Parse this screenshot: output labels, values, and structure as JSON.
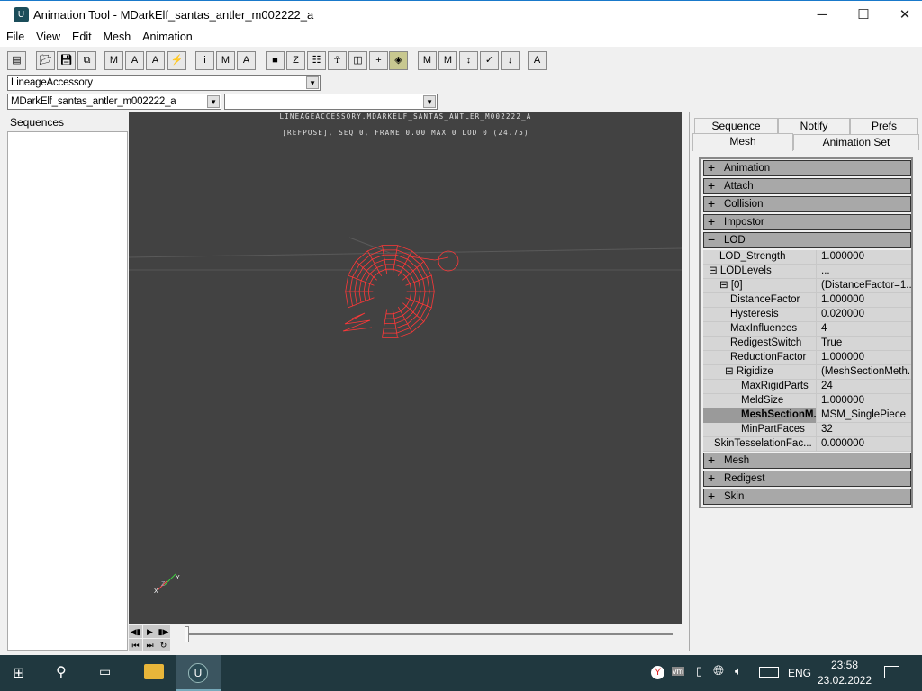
{
  "window": {
    "title": "Animation Tool - MDarkElf_santas_antler_m002222_a",
    "minimize": "─",
    "maximize": "☐",
    "close": "✕"
  },
  "menu": [
    "File",
    "View",
    "Edit",
    "Mesh",
    "Animation"
  ],
  "toolbar": [
    "browser",
    "open",
    "save",
    "copy",
    "mesh-props",
    "anim-props",
    "add-anim",
    "link",
    "info",
    "mesh-import",
    "anim-import",
    "box",
    "bones",
    "skeleton",
    "figure",
    "wireframe",
    "pivot",
    "lod",
    "mesh-export",
    "mesh-save",
    "redigest",
    "check",
    "import-down",
    "actor"
  ],
  "combos": {
    "package": "LineageAccessory",
    "mesh": "MDarkElf_santas_antler_m002222_a",
    "animset": ""
  },
  "left": {
    "sequences_label": "Sequences"
  },
  "viewport": {
    "line1": "LINEAGEACCESSORY.MDARKELF_SANTAS_ANTLER_M002222_A",
    "line2": "[REFPOSE], SEQ 0,  FRAME  0.00 MAX 0  LOD 0 (24.75)",
    "axis": {
      "x": "X",
      "y": "Y",
      "z": "Z"
    },
    "mesh_color": "#ff3838"
  },
  "timeline": {
    "position": 0
  },
  "tabs": {
    "row1": [
      "Sequence",
      "Notify",
      "Prefs"
    ],
    "row2": [
      "Mesh",
      "Animation Set"
    ],
    "active": "Mesh"
  },
  "properties": {
    "categories_top": [
      "Animation",
      "Attach",
      "Collision",
      "Impostor"
    ],
    "lod": "LOD",
    "rows": [
      {
        "name": "LOD_Strength",
        "value": "1.000000",
        "indent": 1
      },
      {
        "name": "⊟ LODLevels",
        "value": "...",
        "indent": 0
      },
      {
        "name": "⊟ [0]",
        "value": "(DistanceFactor=1....",
        "indent": 1
      },
      {
        "name": "DistanceFactor",
        "value": "1.000000",
        "indent": 2
      },
      {
        "name": "Hysteresis",
        "value": "0.020000",
        "indent": 2
      },
      {
        "name": "MaxInfluences",
        "value": "4",
        "indent": 2
      },
      {
        "name": "RedigestSwitch",
        "value": "True",
        "indent": 2
      },
      {
        "name": "ReductionFactor",
        "value": "1.000000",
        "indent": 2
      },
      {
        "name": "⊟ Rigidize",
        "value": "(MeshSectionMeth...",
        "indent": 1.5
      },
      {
        "name": "MaxRigidParts",
        "value": "24",
        "indent": 3
      },
      {
        "name": "MeldSize",
        "value": "1.000000",
        "indent": 3
      },
      {
        "name": "MeshSectionM...",
        "value": "MSM_SinglePiece",
        "indent": 3,
        "selected": true
      },
      {
        "name": "MinPartFaces",
        "value": "32",
        "indent": 3
      },
      {
        "name": "SkinTesselationFac...",
        "value": "0.000000",
        "indent": 0.5
      }
    ],
    "categories_bottom": [
      "Mesh",
      "Redigest",
      "Skin"
    ]
  },
  "taskbar": {
    "time": "23:58",
    "date": "23.02.2022",
    "lang": "ENG"
  }
}
